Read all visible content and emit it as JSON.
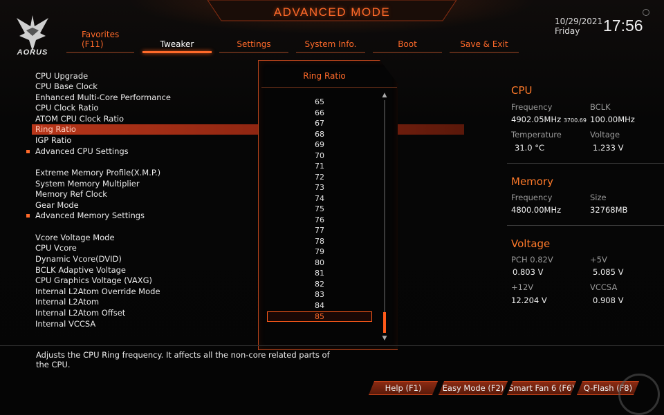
{
  "header": {
    "title": "ADVANCED MODE",
    "logo_text": "AORUS",
    "date": "10/29/2021",
    "day": "Friday",
    "time": "17:56"
  },
  "tabs": [
    {
      "label": "Favorites\n(F11)"
    },
    {
      "label": "Tweaker",
      "active": true
    },
    {
      "label": "Settings"
    },
    {
      "label": "System Info."
    },
    {
      "label": "Boot"
    },
    {
      "label": "Save & Exit"
    }
  ],
  "menu": [
    "CPU Upgrade",
    "CPU Base Clock",
    "Enhanced Multi-Core Performance",
    "CPU Clock Ratio",
    "ATOM CPU Clock Ratio",
    "Ring Ratio",
    "IGP Ratio",
    "Advanced CPU Settings",
    "Extreme Memory Profile(X.M.P.)",
    "System Memory Multiplier",
    "Memory Ref Clock",
    "Gear Mode",
    "Advanced Memory Settings",
    "Vcore Voltage Mode",
    "CPU Vcore",
    "Dynamic Vcore(DVID)",
    "BCLK Adaptive Voltage",
    "CPU Graphics Voltage (VAXG)",
    "Internal L2Atom Override Mode",
    "Internal L2Atom",
    "Internal L2Atom Offset",
    "Internal VCCSA"
  ],
  "popup": {
    "title": "Ring Ratio",
    "options": [
      "65",
      "66",
      "67",
      "68",
      "69",
      "70",
      "71",
      "72",
      "73",
      "74",
      "75",
      "76",
      "77",
      "78",
      "79",
      "80",
      "81",
      "82",
      "83",
      "84",
      "85"
    ],
    "selected": "85",
    "scroll_up": "▲",
    "scroll_down": "▼"
  },
  "cpu": {
    "title": "CPU",
    "frequency_label": "Frequency",
    "frequency_value": "4902.05MHz",
    "frequency_sub": "3700.69",
    "bclk_label": "BCLK",
    "bclk_value": "100.00MHz",
    "temperature_label": "Temperature",
    "temperature_value": "31.0 °C",
    "voltage_label": "Voltage",
    "voltage_value": "1.233 V"
  },
  "memory": {
    "title": "Memory",
    "frequency_label": "Frequency",
    "frequency_value": "4800.00MHz",
    "size_label": "Size",
    "size_value": "32768MB"
  },
  "voltage": {
    "title": "Voltage",
    "pch_label": "PCH 0.82V",
    "pch_value": "0.803 V",
    "v5_label": "+5V",
    "v5_value": "5.085 V",
    "v12_label": "+12V",
    "v12_value": "12.204 V",
    "vccsa_label": "VCCSA",
    "vccsa_value": "0.908 V"
  },
  "help_text": "Adjusts the CPU Ring frequency. It affects all the non-core related parts of the CPU.",
  "buttons": {
    "help": "Help (F1)",
    "easy": "Easy Mode (F2)",
    "fan": "Smart Fan 6 (F6)",
    "qflash": "Q-Flash (F8)"
  },
  "colors": {
    "accent": "#ff6a2a",
    "highlight": "#b8361a",
    "background": "#070707"
  }
}
